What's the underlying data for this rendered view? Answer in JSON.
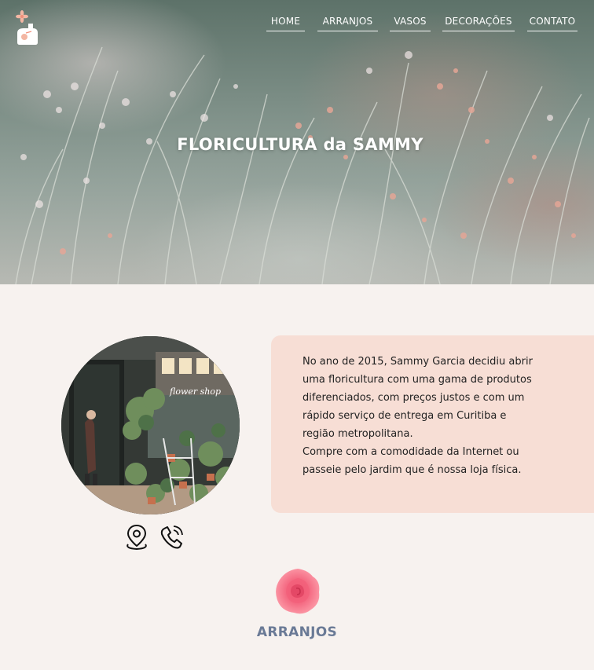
{
  "nav": {
    "items": [
      {
        "label": "HOME"
      },
      {
        "label": "ARRANJOS"
      },
      {
        "label": "VASOS"
      },
      {
        "label": "DECORAÇÕES"
      },
      {
        "label": "CONTATO"
      }
    ]
  },
  "hero": {
    "title": "FLORICULTURA da SAMMY"
  },
  "about": {
    "paragraph1": "No ano de 2015, Sammy Garcia decidiu abrir uma floricultura com uma gama de produtos diferenciados, com preços justos e com um rápido serviço de entrega em Curitiba e região metropolitana.",
    "paragraph2": "Compre com a comodidade da Internet ou passeie pelo jardim que é nossa loja física.",
    "shop_sign": "flower shop"
  },
  "sections": {
    "arranjos_title": "ARRANJOS"
  },
  "colors": {
    "page_background": "#f7f2ef",
    "about_card": "#f7ded5",
    "section_title": "#6a7a96",
    "rose": "#f56f86"
  }
}
